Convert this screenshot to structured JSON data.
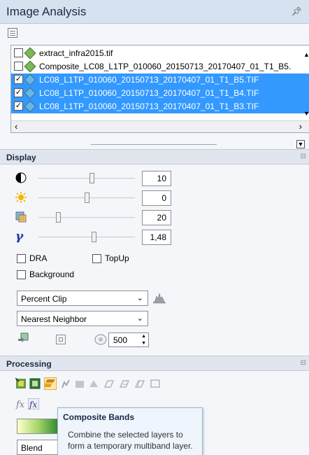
{
  "window": {
    "title": "Image Analysis",
    "pin_icon": "pin-icon"
  },
  "layers": [
    {
      "name": "extract_infra2015.tif",
      "checked": false,
      "selected": false
    },
    {
      "name": "Composite_LC08_L1TP_010060_20150713_20170407_01_T1_B5.",
      "checked": false,
      "selected": false
    },
    {
      "name": "LC08_L1TP_010060_20150713_20170407_01_T1_B5.TIF",
      "checked": true,
      "selected": true
    },
    {
      "name": "LC08_L1TP_010060_20150713_20170407_01_T1_B4.TIF",
      "checked": true,
      "selected": true
    },
    {
      "name": "LC08_L1TP_010060_20150713_20170407_01_T1_B3.TIF",
      "checked": true,
      "selected": true
    }
  ],
  "display": {
    "header": "Display",
    "brightness": {
      "value": "10",
      "level": 0.55
    },
    "contrast": {
      "value": "0",
      "level": 0.5
    },
    "transparency": {
      "value": "20",
      "level": 0.2
    },
    "gamma": {
      "value": "1,48",
      "level": 0.57
    },
    "dra_label": "DRA",
    "topup_label": "TopUp",
    "background_label": "Background",
    "stretch_value": "Percent Clip",
    "resample_value": "Nearest Neighbor",
    "zoom_value": "500"
  },
  "processing": {
    "header": "Processing",
    "blend_value": "Blend"
  },
  "tooltip": {
    "title": "Composite Bands",
    "description": "Combine the selected layers to form a temporary multiband layer."
  },
  "colors": {
    "selection": "#3399ff",
    "panel": "#d7e2f1"
  }
}
